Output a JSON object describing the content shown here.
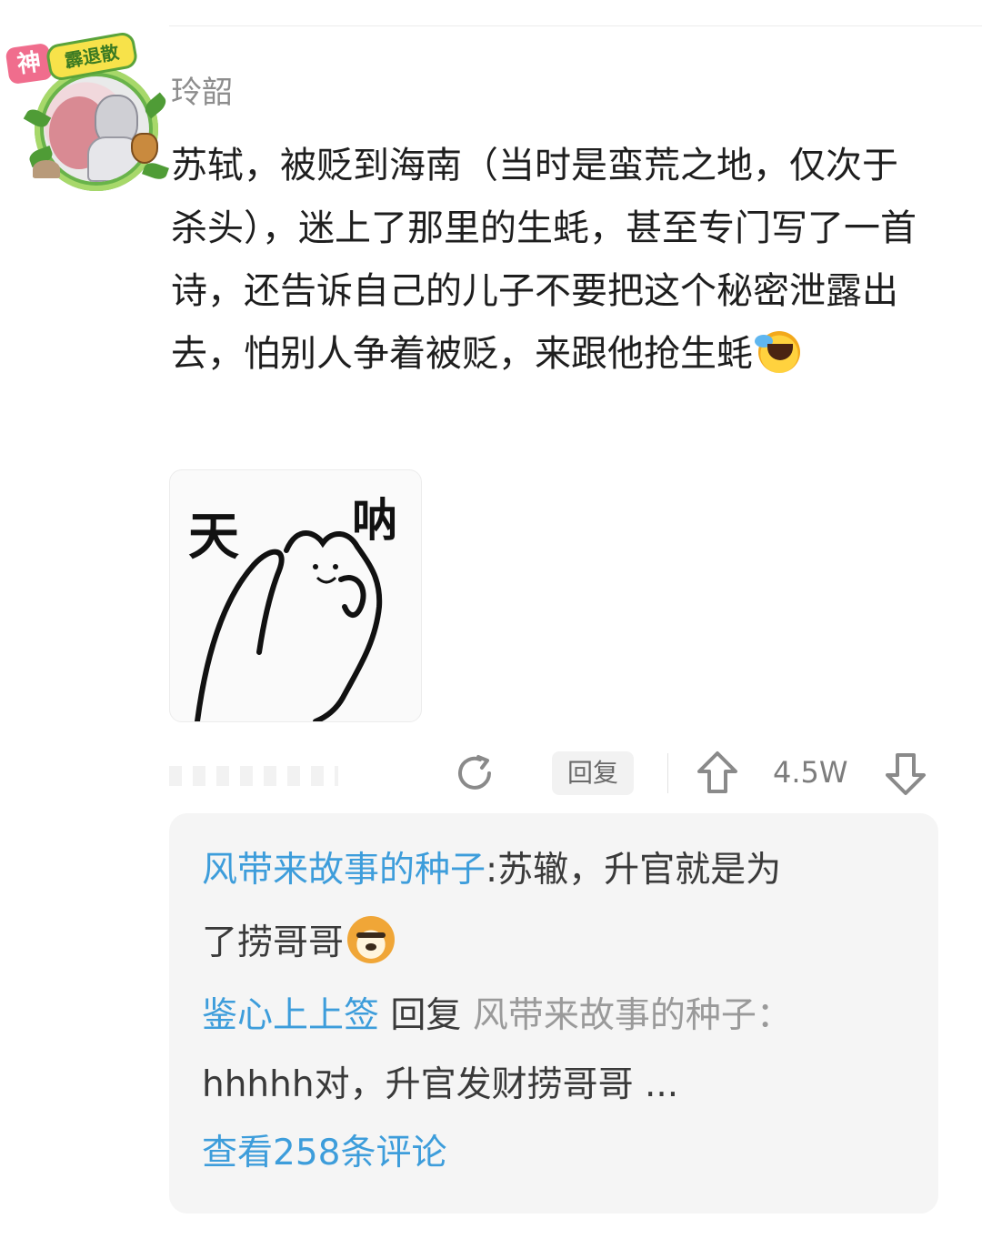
{
  "comment": {
    "username": "玲韶",
    "text": "苏轼，被贬到海南（当时是蛮荒之地，仅次于杀头），迷上了那里的生蚝，甚至专门写了一首诗，还告诉自己的儿子不要把这个秘密泄露出去，怕别人争着被贬，来跟他抢生蚝",
    "avatar_badge": "神",
    "avatar_badge2": "霹退散",
    "sticker_text_left": "天",
    "sticker_text_right": "呐"
  },
  "actions": {
    "reply_label": "回复",
    "like_count": "4.5W"
  },
  "replies": [
    {
      "author": "风带来故事的种子",
      "separator": ":",
      "text_line1": "苏辙，升官就是为",
      "text_line2": "了捞哥哥"
    },
    {
      "author": "鉴心上上签",
      "reply_word": "回复",
      "reply_to": "风带来故事的种子",
      "colon": "：",
      "text": "hhhhh对，升官发财捞哥哥 ..."
    }
  ],
  "view_more": "查看258条评论",
  "colors": {
    "link_blue": "#3d9ddb",
    "username_gray": "#8d8d8d",
    "reply_panel_bg": "#f5f5f5"
  }
}
